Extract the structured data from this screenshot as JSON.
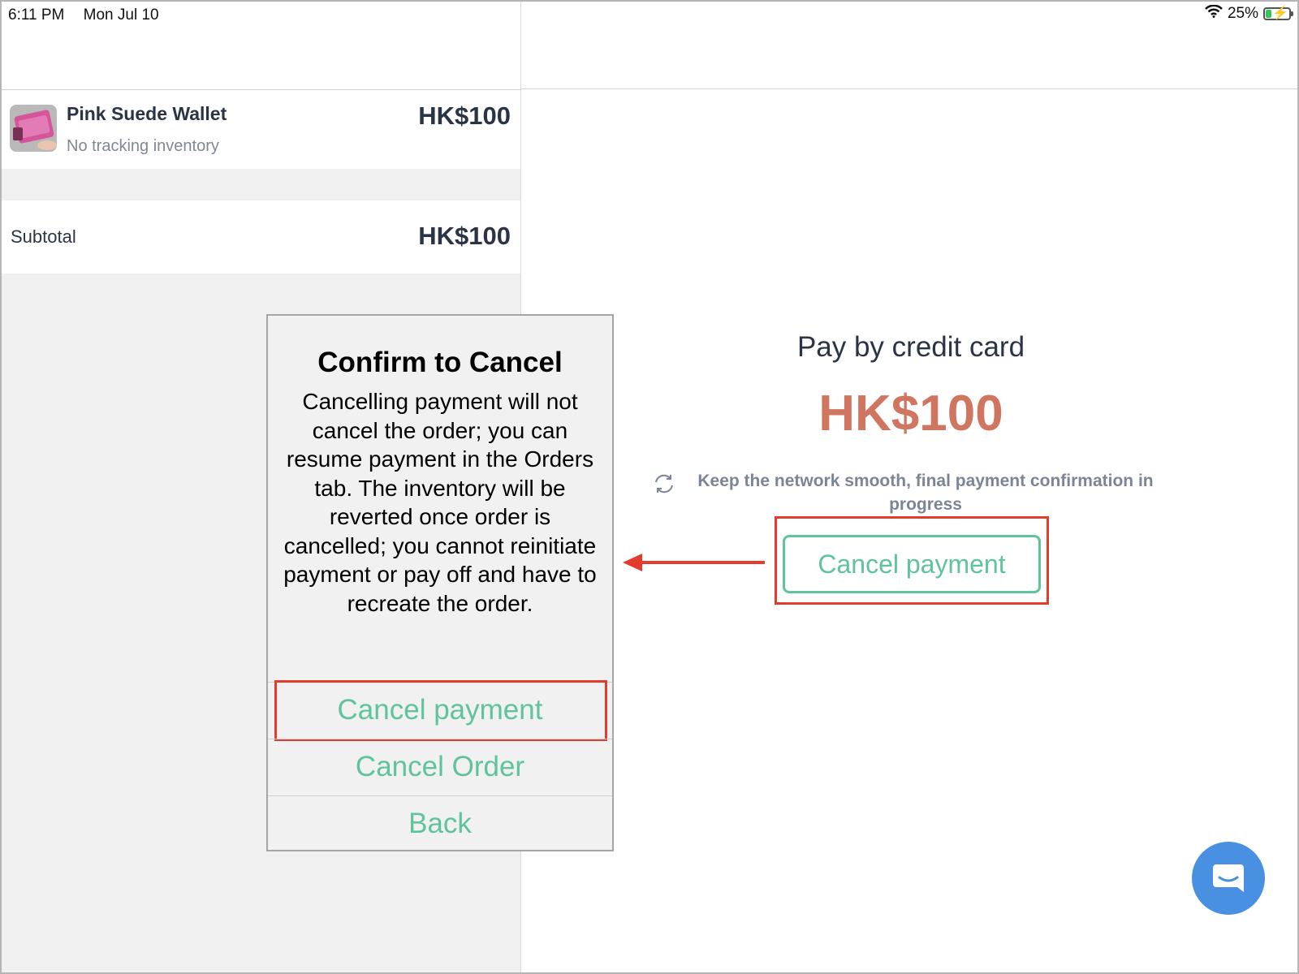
{
  "status_bar": {
    "time": "6:11 PM",
    "date": "Mon Jul 10",
    "battery": "25%",
    "battery_level": 0.25,
    "wifi_icon": "wifi-icon"
  },
  "cart": {
    "items": [
      {
        "name": "Pink Suede Wallet",
        "subtitle": "No tracking inventory",
        "price": "HK$100"
      }
    ],
    "subtotal_label": "Subtotal",
    "subtotal_value": "HK$100"
  },
  "payment": {
    "title": "Pay by credit card",
    "amount": "HK$100",
    "note": "Keep the network smooth, final payment confirmation in progress",
    "cancel_button": "Cancel payment"
  },
  "dialog": {
    "title": "Confirm to Cancel",
    "message": "Cancelling payment will not cancel the order; you can resume payment in the Orders tab. The inventory will be reverted once order is cancelled; you cannot reinitiate payment or pay off and have to recreate the order.",
    "actions": [
      "Cancel payment",
      "Cancel Order",
      "Back"
    ]
  },
  "colors": {
    "accent": "#5fc39b",
    "amount": "#d07560",
    "highlight": "#e23c2c",
    "chat": "#4a90e2"
  }
}
